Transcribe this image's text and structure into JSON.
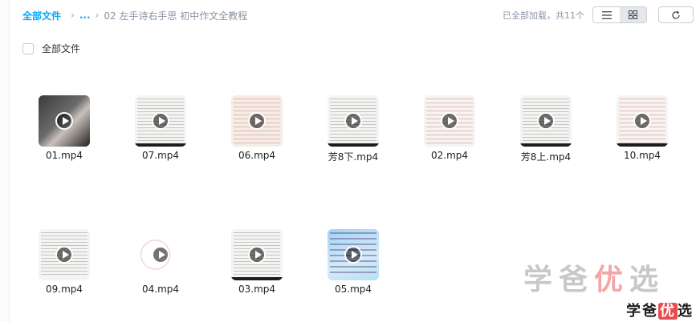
{
  "breadcrumb": {
    "root": "全部文件",
    "separator": "›",
    "ellipsis": "...",
    "current": "02 左手诗右手思 初中作文全教程"
  },
  "status": "已全部加载，共11个",
  "view": {
    "list_icon": "list-view-icon",
    "grid_icon": "grid-view-icon",
    "active": "grid"
  },
  "refresh_icon": "refresh-icon",
  "select_all_label": "全部文件",
  "files": [
    {
      "name": "01.mp4"
    },
    {
      "name": "07.mp4"
    },
    {
      "name": "06.mp4"
    },
    {
      "name": "芳8下.mp4"
    },
    {
      "name": "02.mp4"
    },
    {
      "name": "芳8上.mp4"
    },
    {
      "name": "10.mp4"
    },
    {
      "name": "09.mp4"
    },
    {
      "name": "04.mp4"
    },
    {
      "name": "03.mp4"
    },
    {
      "name": "05.mp4"
    }
  ],
  "watermark": {
    "a": "学爸",
    "b": "优",
    "c": "选"
  },
  "colors": {
    "accent": "#06a7ff",
    "muted": "#8a94a6"
  }
}
